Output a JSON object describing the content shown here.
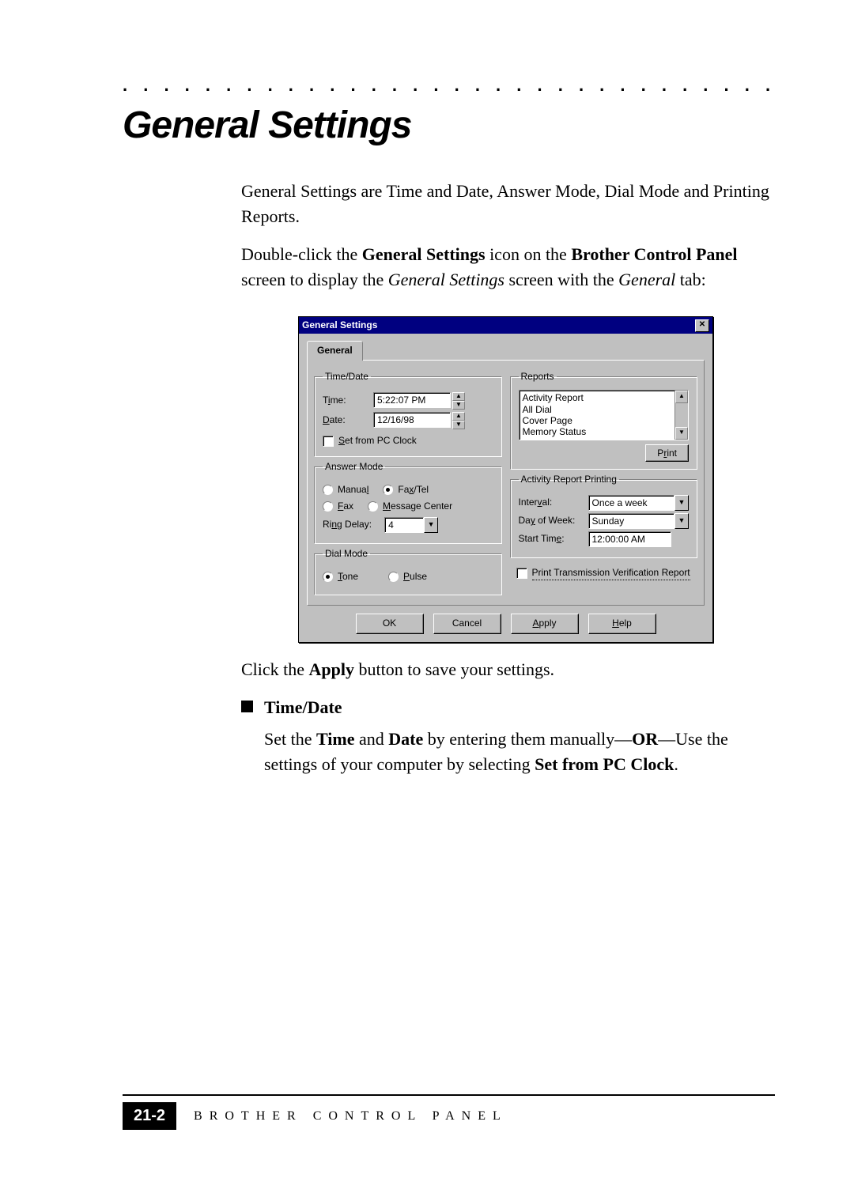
{
  "doc": {
    "title": "General Settings",
    "intro_1": "General Settings are Time and Date, Answer Mode, Dial Mode and Printing Reports.",
    "intro_2a": "Double-click the ",
    "intro_2b": "General Settings",
    "intro_2c": " icon on the ",
    "intro_2d": "Brother Control Panel",
    "intro_2e": " screen to display the ",
    "intro_2f": "General Settings",
    "intro_2g": " screen with the ",
    "intro_2h": "General",
    "intro_2i": " tab:",
    "after_dialog_a": "Click the ",
    "after_dialog_b": "Apply",
    "after_dialog_c": " button to save your settings.",
    "bullet_heading": "Time/Date",
    "bullet_body_a": "Set the ",
    "bullet_body_b": "Time",
    "bullet_body_c": " and ",
    "bullet_body_d": "Date",
    "bullet_body_e": " by entering them manually—",
    "bullet_body_f": "OR",
    "bullet_body_g": "—Use the settings of your computer by selecting ",
    "bullet_body_h": "Set from PC Clock",
    "bullet_body_i": "."
  },
  "dialog": {
    "title": "General Settings",
    "tab": "General",
    "timedate": {
      "legend": "Time/Date",
      "time_label_pre": "T",
      "time_label_ul": "i",
      "time_label_post": "me:",
      "time_value": "5:22:07 PM",
      "date_label_ul": "D",
      "date_label_post": "ate:",
      "date_value": "12/16/98",
      "setpc_ul": "S",
      "setpc_post": "et from PC Clock"
    },
    "answermode": {
      "legend": "Answer Mode",
      "manual_pre": "Manua",
      "manual_ul": "l",
      "faxtel_pre": "Fa",
      "faxtel_ul": "x",
      "faxtel_post": "/Tel",
      "fax_ul": "F",
      "fax_post": "ax",
      "mc_ul": "M",
      "mc_post": "essage Center",
      "ringdelay_pre": "Ri",
      "ringdelay_ul": "n",
      "ringdelay_post": "g Delay:",
      "ringdelay_value": "4"
    },
    "dialmode": {
      "legend": "Dial Mode",
      "tone_ul": "T",
      "tone_post": "one",
      "pulse_ul": "P",
      "pulse_post": "ulse"
    },
    "reports": {
      "legend": "Reports",
      "items": [
        "Activity Report",
        "All Dial",
        "Cover Page",
        "Memory Status"
      ],
      "print_pre": "P",
      "print_ul": "r",
      "print_post": "int"
    },
    "arp": {
      "legend": "Activity Report Printing",
      "interval_label_pre": "Inter",
      "interval_label_ul": "v",
      "interval_label_post": "al:",
      "interval_value": "Once a week",
      "dow_label_pre": "Da",
      "dow_label_ul": "y",
      "dow_label_post": " of Week:",
      "dow_value": "Sunday",
      "start_label_pre": "Start Tim",
      "start_label_ul": "e",
      "start_label_post": ":",
      "start_value": "12:00:00 AM"
    },
    "ptv_label": "Print Transmission Verification Report",
    "buttons": {
      "ok": "OK",
      "cancel": "Cancel",
      "apply_ul": "A",
      "apply_post": "pply",
      "help_ul": "H",
      "help_post": "elp"
    }
  },
  "footer": {
    "page": "21-2",
    "section": "BROTHER CONTROL PANEL"
  }
}
